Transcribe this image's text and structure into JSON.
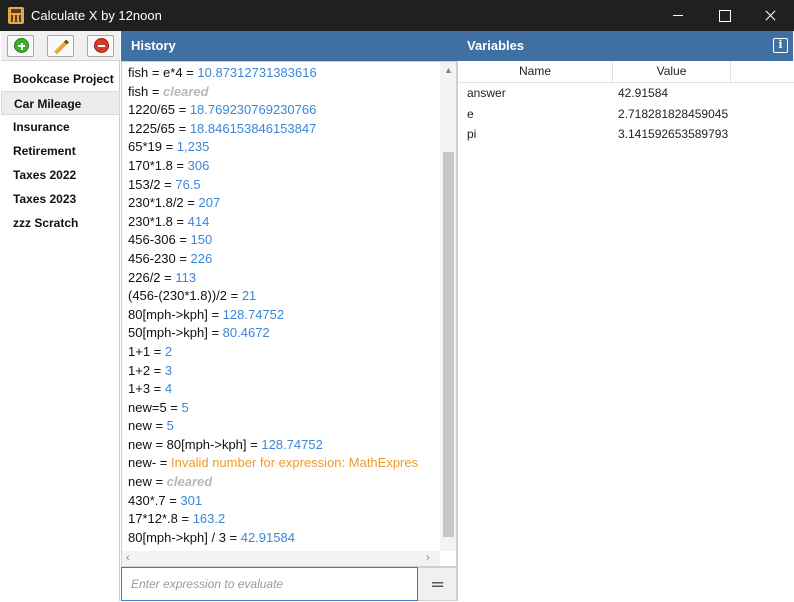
{
  "window": {
    "title": "Calculate X by 12noon"
  },
  "workspaces": {
    "items": [
      {
        "label": "Bookcase Project",
        "selected": false
      },
      {
        "label": "Car Mileage",
        "selected": true
      },
      {
        "label": "Insurance",
        "selected": false
      },
      {
        "label": "Retirement",
        "selected": false
      },
      {
        "label": "Taxes 2022",
        "selected": false
      },
      {
        "label": "Taxes 2023",
        "selected": false
      },
      {
        "label": "zzz Scratch",
        "selected": false
      }
    ]
  },
  "history": {
    "title": "History",
    "lines": [
      {
        "expr": "fish = e*4 = ",
        "result": "10.87312731383616",
        "kind": "value"
      },
      {
        "expr": "fish = ",
        "result": "cleared",
        "kind": "cleared"
      },
      {
        "expr": "1220/65 = ",
        "result": "18.769230769230766",
        "kind": "value"
      },
      {
        "expr": "1225/65 = ",
        "result": "18.846153846153847",
        "kind": "value"
      },
      {
        "expr": "65*19 = ",
        "result": "1,235",
        "kind": "value"
      },
      {
        "expr": "170*1.8 = ",
        "result": "306",
        "kind": "value"
      },
      {
        "expr": "153/2 = ",
        "result": "76.5",
        "kind": "value"
      },
      {
        "expr": "230*1.8/2 = ",
        "result": "207",
        "kind": "value"
      },
      {
        "expr": "230*1.8 = ",
        "result": "414",
        "kind": "value"
      },
      {
        "expr": "456-306 = ",
        "result": "150",
        "kind": "value"
      },
      {
        "expr": "456-230 = ",
        "result": "226",
        "kind": "value"
      },
      {
        "expr": "226/2 = ",
        "result": "113",
        "kind": "value"
      },
      {
        "expr": "(456-(230*1.8))/2 = ",
        "result": "21",
        "kind": "value"
      },
      {
        "expr": "80[mph->kph] = ",
        "result": "128.74752",
        "kind": "value"
      },
      {
        "expr": "50[mph->kph] = ",
        "result": "80.4672",
        "kind": "value"
      },
      {
        "expr": "1+1 = ",
        "result": "2",
        "kind": "value"
      },
      {
        "expr": "1+2 = ",
        "result": "3",
        "kind": "value"
      },
      {
        "expr": "1+3 = ",
        "result": "4",
        "kind": "value"
      },
      {
        "expr": "new=5 = ",
        "result": "5",
        "kind": "value"
      },
      {
        "expr": "new = ",
        "result": "5",
        "kind": "value"
      },
      {
        "expr": "new = 80[mph->kph] = ",
        "result": "128.74752",
        "kind": "value"
      },
      {
        "expr": "new- = ",
        "result": "Invalid number for expression: MathExpres",
        "kind": "error"
      },
      {
        "expr": "new = ",
        "result": "cleared",
        "kind": "cleared"
      },
      {
        "expr": "430*.7 = ",
        "result": "301",
        "kind": "value"
      },
      {
        "expr": "17*12*.8 = ",
        "result": "163.2",
        "kind": "value"
      },
      {
        "expr": "80[mph->kph] / 3 = ",
        "result": "42.91584",
        "kind": "value"
      }
    ]
  },
  "input": {
    "placeholder": "Enter expression to evaluate",
    "value": ""
  },
  "evaluate": {
    "label": "="
  },
  "variables": {
    "title": "Variables",
    "info_label": "i",
    "columns": {
      "name": "Name",
      "value": "Value"
    },
    "rows": [
      {
        "name": "answer",
        "value": "42.91584"
      },
      {
        "name": "e",
        "value": "2.718281828459045"
      },
      {
        "name": "pi",
        "value": "3.141592653589793"
      }
    ]
  },
  "colors": {
    "header_blue": "#3f6fa3",
    "result_blue": "#3b87d6",
    "error_orange": "#f09a2a",
    "cleared_gray": "#b8b8b8"
  }
}
